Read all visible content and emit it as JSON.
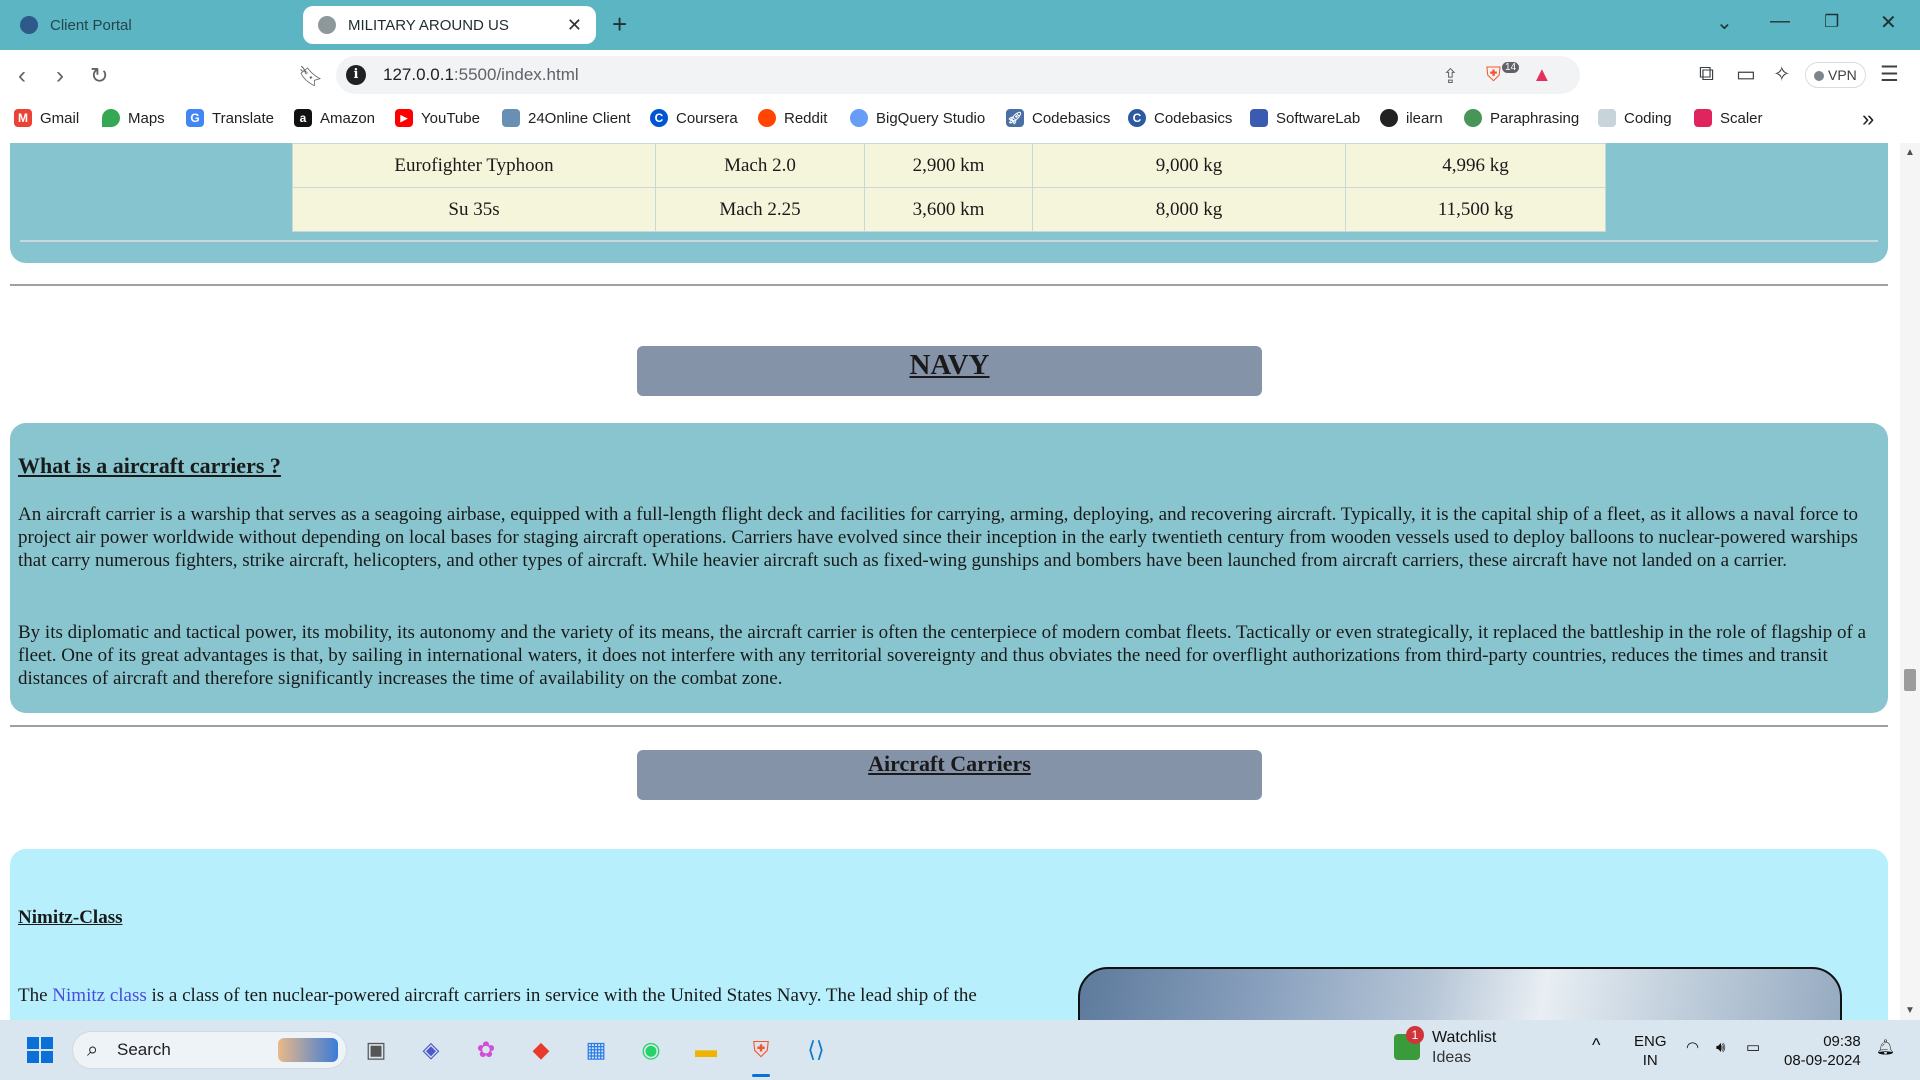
{
  "browser": {
    "tabs": [
      {
        "title": "Client Portal",
        "active": false
      },
      {
        "title": "MILITARY AROUND US",
        "active": true
      }
    ],
    "url_host": "127.0.0.1",
    "url_path": ":5500/index.html",
    "shield_count": "14",
    "vpn_label": "VPN",
    "bookmarks": [
      "Gmail",
      "Maps",
      "Translate",
      "Amazon",
      "YouTube",
      "24Online Client",
      "Coursera",
      "Reddit",
      "BigQuery Studio",
      "Codebasics",
      "Codebasics",
      "SoftwareLab",
      "ilearn",
      "Paraphrasing",
      "Coding",
      "Scaler"
    ]
  },
  "page": {
    "jets_table": [
      [
        "Eurofighter Typhoon",
        "Mach 2.0",
        "2,900 km",
        "9,000 kg",
        "4,996 kg"
      ],
      [
        "Su 35s",
        "Mach 2.25",
        "3,600 km",
        "8,000 kg",
        "11,500 kg"
      ]
    ],
    "navy_heading": "NAVY",
    "carrier_question": "What is a aircraft carriers ?",
    "carrier_para1": "An aircraft carrier is a warship that serves as a seagoing airbase, equipped with a full-length flight deck and facilities for carrying, arming, deploying, and recovering aircraft. Typically, it is the capital ship of a fleet, as it allows a naval force to project air power worldwide without depending on local bases for staging aircraft operations. Carriers have evolved since their inception in the early twentieth century from wooden vessels used to deploy balloons to nuclear-powered warships that carry numerous fighters, strike aircraft, helicopters, and other types of aircraft. While heavier aircraft such as fixed-wing gunships and bombers have been launched from aircraft carriers, these aircraft have not landed on a carrier.",
    "carrier_para2": "By its diplomatic and tactical power, its mobility, its autonomy and the variety of its means, the aircraft carrier is often the centerpiece of modern combat fleets. Tactically or even strategically, it replaced the battleship in the role of flagship of a fleet. One of its great advantages is that, by sailing in international waters, it does not interfere with any territorial sovereignty and thus obviates the need for overflight authorizations from third-party countries, reduces the times and transit distances of aircraft and therefore significantly increases the time of availability on the combat zone.",
    "carriers_heading": "Aircraft Carriers",
    "nimitz_heading": "Nimitz-Class",
    "nimitz_text_before": "The ",
    "nimitz_link": "Nimitz class",
    "nimitz_text_after": " is a class of ten nuclear-powered aircraft carriers in service with the United States Navy. The lead ship of the"
  },
  "taskbar": {
    "search_label": "Search",
    "watchlist_title": "Watchlist",
    "watchlist_sub": "Ideas",
    "watchlist_badge": "1",
    "lang_top": "ENG",
    "lang_bottom": "IN",
    "time": "09:38",
    "date": "08-09-2024"
  }
}
